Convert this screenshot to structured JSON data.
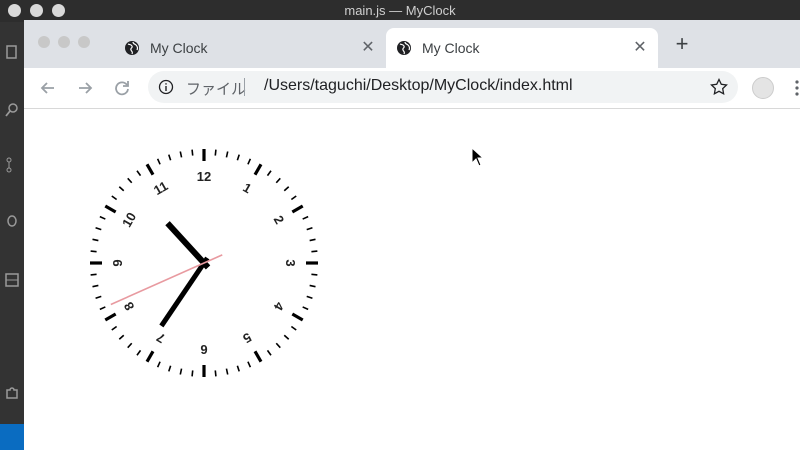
{
  "vscode": {
    "title": "main.js — MyClock",
    "activity_icons": [
      "files-icon",
      "search-icon",
      "source-control-icon",
      "debug-icon",
      "extensions-icon",
      "puzzle-icon"
    ]
  },
  "browser": {
    "tabs": [
      {
        "label": "My Clock",
        "active": false
      },
      {
        "label": "My Clock",
        "active": true
      }
    ],
    "address": {
      "scheme_label": "ファイル",
      "url": "/Users/taguchi/Desktop/MyClock/index.html"
    }
  },
  "clock": {
    "numbers": [
      "12",
      "1",
      "2",
      "3",
      "4",
      "5",
      "6",
      "7",
      "8",
      "9",
      "10",
      "11"
    ],
    "time": {
      "hour": 10,
      "minute": 35,
      "second": 41
    },
    "colors": {
      "hands": "#000000",
      "second_hand": "#e89aa0",
      "ticks": "#000000"
    }
  }
}
